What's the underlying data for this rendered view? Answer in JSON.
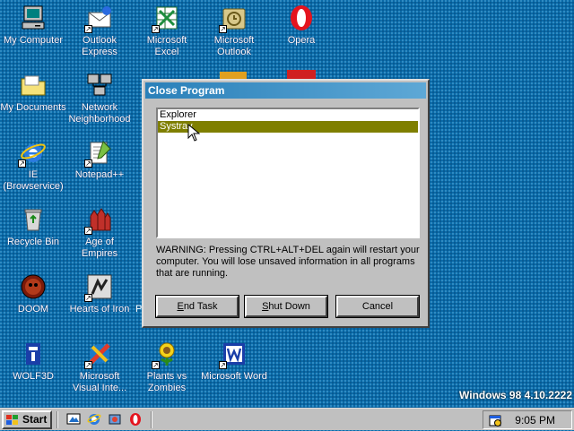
{
  "desktop": {
    "icons": [
      {
        "label": "My Computer",
        "icon": "computer-icon"
      },
      {
        "label": "My Documents",
        "icon": "folder-icon"
      },
      {
        "label": "IE (Browservice)",
        "icon": "ie-icon"
      },
      {
        "label": "Recycle Bin",
        "icon": "recycle-bin-icon"
      },
      {
        "label": "DOOM",
        "icon": "doom-icon"
      },
      {
        "label": "WOLF3D",
        "icon": "wolf3d-icon"
      },
      {
        "label": "Outlook Express",
        "icon": "outlook-express-icon"
      },
      {
        "label": "Network Neighborhood",
        "icon": "network-icon"
      },
      {
        "label": "Notepad++",
        "icon": "notepad-icon"
      },
      {
        "label": "Age of Empires",
        "icon": "age-of-empires-icon"
      },
      {
        "label": "Hearts of Iron",
        "icon": "hearts-of-iron-icon"
      },
      {
        "label": "Microsoft Visual Inte...",
        "icon": "visual-interdev-icon"
      },
      {
        "label": "Microsoft Excel",
        "icon": "excel-icon"
      },
      {
        "label": "Plants vs Zombies",
        "icon": "plants-vs-zombies-icon"
      },
      {
        "label": "Microsoft Outlook",
        "icon": "outlook-icon"
      },
      {
        "label": "Microsoft Word",
        "icon": "word-icon"
      },
      {
        "label": "Opera",
        "icon": "opera-icon"
      }
    ],
    "partial_label": "P",
    "version_text": "Windows 98 4.10.2222"
  },
  "dialog": {
    "title": "Close Program",
    "programs": [
      "Explorer",
      "Systray"
    ],
    "selected_index": 1,
    "warning": "WARNING: Pressing CTRL+ALT+DEL again will restart your computer. You will lose unsaved information in all programs that are running.",
    "buttons": {
      "end_task_u": "E",
      "end_task_rest": "nd Task",
      "shut_down_u": "S",
      "shut_down_rest": "hut Down",
      "cancel": "Cancel"
    }
  },
  "taskbar": {
    "start_label": "Start",
    "quick_launch": [
      "show-desktop-icon",
      "ie-icon",
      "channels-icon",
      "opera-icon"
    ],
    "tray_icon": "scheduler-icon",
    "clock": "9:05 PM"
  },
  "colors": {
    "desktop": "#0a6aa8",
    "titlebar": "#2a80b9",
    "selection": "#7f7f00"
  }
}
